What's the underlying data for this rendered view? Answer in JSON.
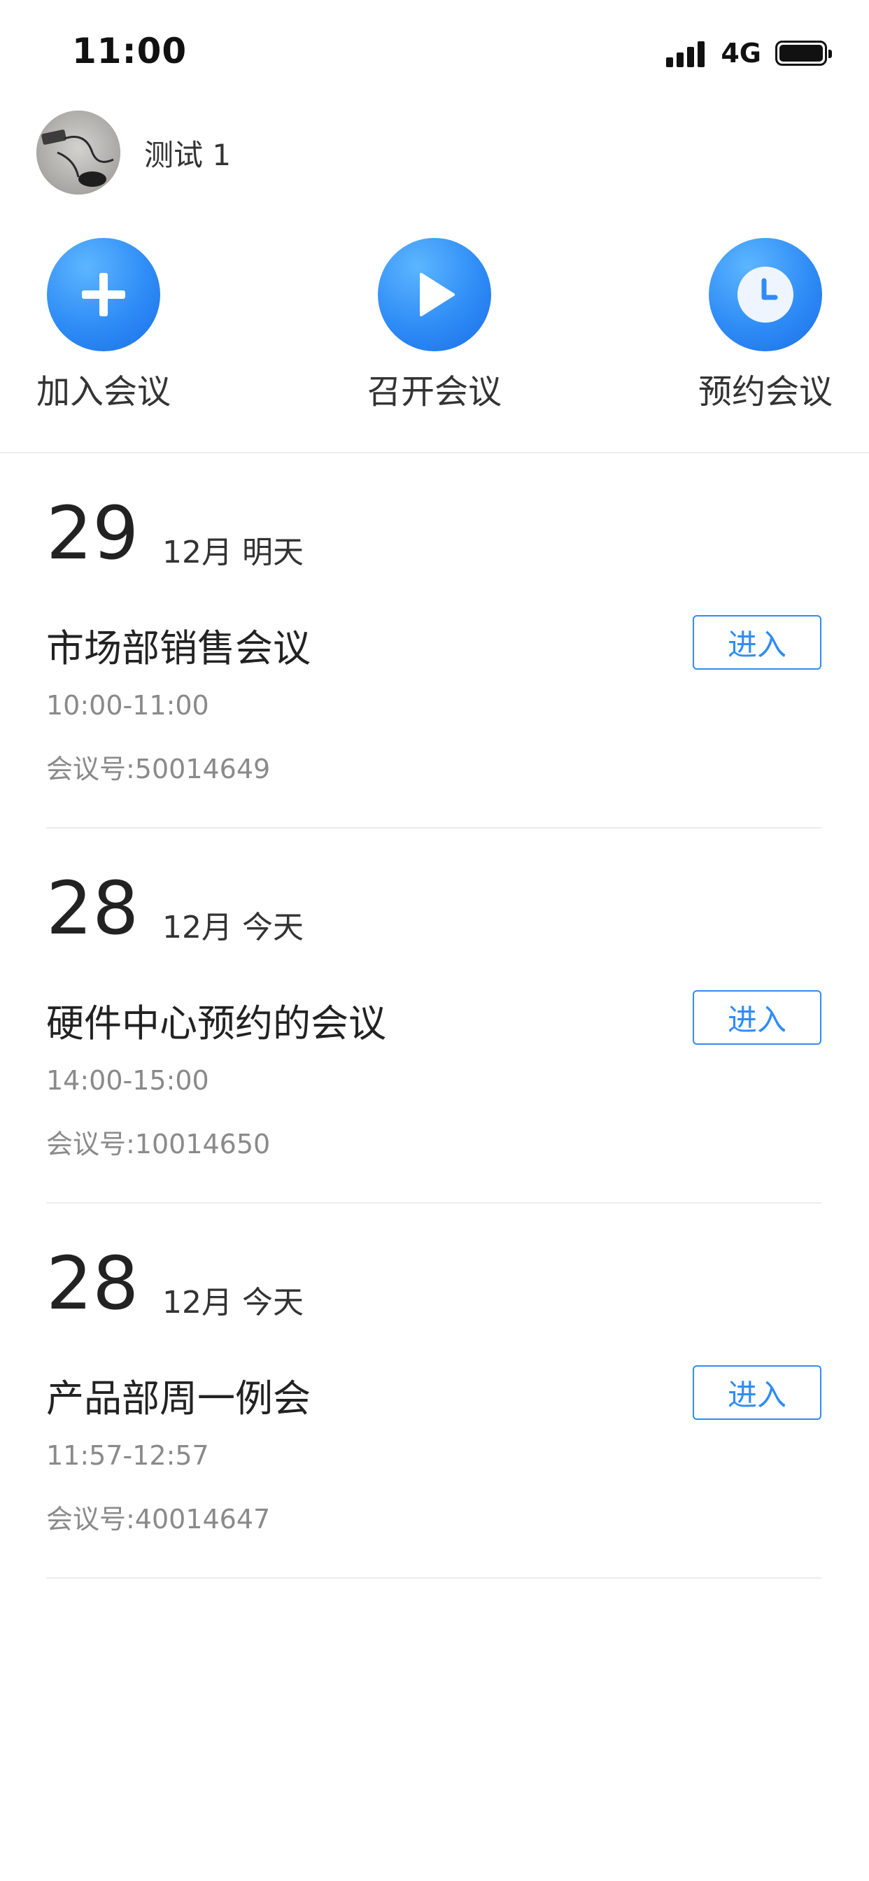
{
  "status_bar": {
    "time": "11:00",
    "network": "4G",
    "signal_icon": "cellular-signal-icon",
    "battery_icon": "battery-full-icon"
  },
  "user": {
    "name": "测试 1",
    "avatar_icon": "user-avatar-photo"
  },
  "actions": [
    {
      "label": "加入会议",
      "icon": "plus-icon"
    },
    {
      "label": "召开会议",
      "icon": "play-icon"
    },
    {
      "label": "预约会议",
      "icon": "clock-icon"
    }
  ],
  "meetings": [
    {
      "day": "29",
      "month": "12月",
      "relative_day": "明天",
      "title": "市场部销售会议",
      "time": "10:00-11:00",
      "meeting_number": "会议号:50014649",
      "enter_label": "进入"
    },
    {
      "day": "28",
      "month": "12月",
      "relative_day": "今天",
      "title": "硬件中心预约的会议",
      "time": "14:00-15:00",
      "meeting_number": "会议号:10014650",
      "enter_label": "进入"
    },
    {
      "day": "28",
      "month": "12月",
      "relative_day": "今天",
      "title": "产品部周一例会",
      "time": "11:57-12:57",
      "meeting_number": "会议号:40014647",
      "enter_label": "进入"
    }
  ],
  "colors": {
    "accent": "#2f8cf6",
    "secondary_text": "#8a8a8a",
    "divider": "#ececec"
  }
}
